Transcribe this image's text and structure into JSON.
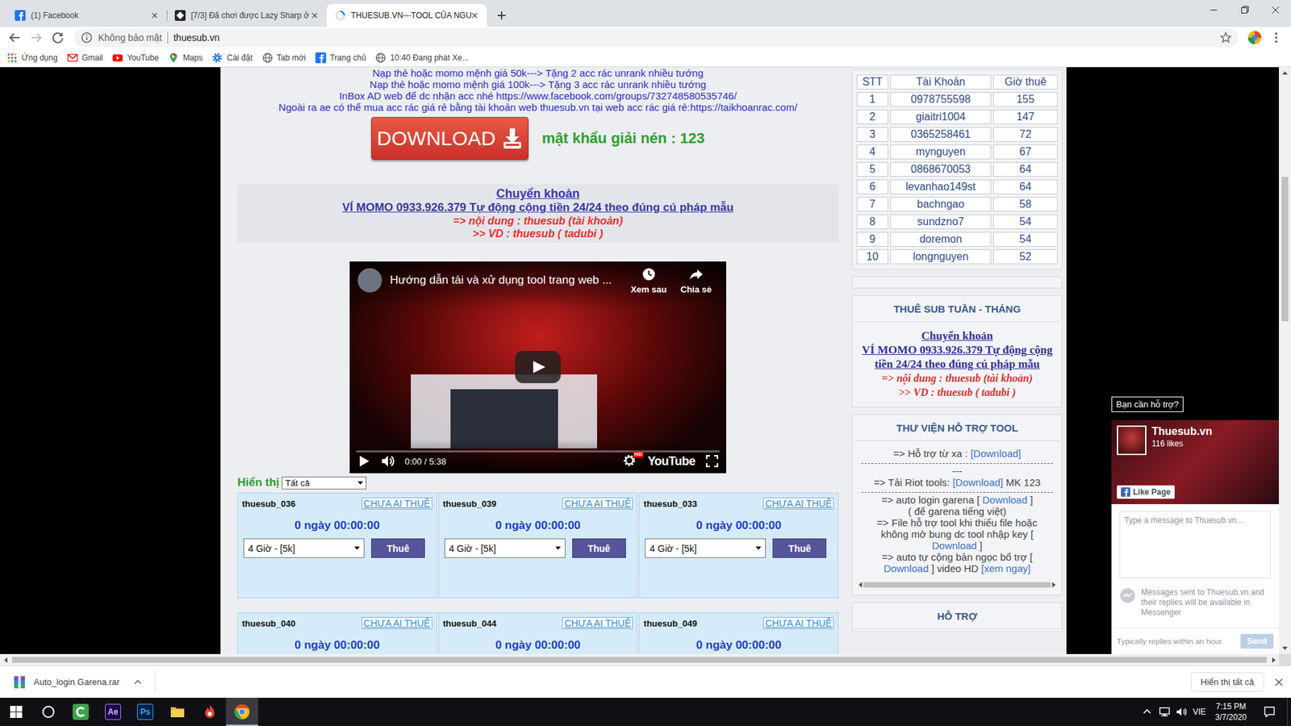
{
  "browser": {
    "tabs": [
      {
        "label": "(1) Facebook",
        "kind": "facebook",
        "selected": false
      },
      {
        "label": "[7/3] Đã chơi được Lazy Sharp ở",
        "kind": "forum",
        "selected": false
      },
      {
        "label": "THUESUB.VN---TOOL CỦA NGU",
        "kind": "site",
        "selected": true
      }
    ],
    "forward_disabled": true,
    "address": {
      "security": "Không bảo mật",
      "url": "thuesub.vn"
    },
    "bookmarks": [
      {
        "label": "Ứng dụng",
        "kind": "apps"
      },
      {
        "label": "Gmail",
        "kind": "gmail"
      },
      {
        "label": "YouTube",
        "kind": "youtube"
      },
      {
        "label": "Maps",
        "kind": "maps"
      },
      {
        "label": "Cài đặt",
        "kind": "settings"
      },
      {
        "label": "Tab mới",
        "kind": "globe"
      },
      {
        "label": "Trang chủ",
        "kind": "facebook"
      },
      {
        "label": "10:40 Đang phát Xe...",
        "kind": "globe"
      }
    ]
  },
  "page": {
    "promo_lines": [
      "Nạp thẻ hoặc momo mệnh giá 50k---> Tặng 2 acc rác unrank nhiều tướng",
      "Nạp thẻ hoặc momo mệnh giá 100k---> Tặng 3 acc rác unrank nhiều tướng",
      "InBox AD web để dc nhận acc nhé https://www.facebook.com/groups/732748580535746/",
      "Ngoài ra ae có thể mua acc rác giá rẻ bằng tài khoản web thuesub.vn tại web acc rác giá rẻ:https://taikhoanrac.com/"
    ],
    "download_button": "DOWNLOAD",
    "unzip_password": "mật khẩu giải nén : 123",
    "payment": {
      "title": "Chuyển khoản ",
      "wallet": "VÍ MOMO 0933.926.379 Tự động cộng tiền 24/24 theo đúng cú pháp mẫu ",
      "content": "=> nội dung : thuesub (tài khoản)",
      "example": ">> VD : thuesub ( tadubi )"
    },
    "video": {
      "title": "Hướng dẫn tải và xử dụng tool trang web ...",
      "watch_later": "Xem sau",
      "share": "Chia sẻ",
      "time": "0:00 / 5:38",
      "hd_badge": "HD",
      "brand": "YouTube",
      "level": 0
    },
    "filter": {
      "label": "Hiển thị",
      "value": "Tất cả"
    },
    "accounts": [
      {
        "name": "thuesub_036",
        "status": "CHƯA AI THUÊ",
        "time": "0 ngày 00:00:00",
        "plan": "4 Giờ - [5k]",
        "button": "Thuê"
      },
      {
        "name": "thuesub_039",
        "status": "CHƯA AI THUÊ",
        "time": "0 ngày 00:00:00",
        "plan": "4 Giờ - [5k]",
        "button": "Thuê"
      },
      {
        "name": "thuesub_033",
        "status": "CHƯA AI THUÊ",
        "time": "0 ngày 00:00:00",
        "plan": "4 Giờ - [5k]",
        "button": "Thuê"
      },
      {
        "name": "thuesub_040",
        "status": "CHƯA AI THUÊ",
        "time": "0 ngày 00:00:00"
      },
      {
        "name": "thuesub_044",
        "status": "CHƯA AI THUÊ",
        "time": "0 ngày 00:00:00"
      },
      {
        "name": "thuesub_049",
        "status": "CHƯA AI THUÊ",
        "time": "0 ngày 00:00:00"
      }
    ]
  },
  "sidebar": {
    "leaderboard": {
      "columns": [
        "STT",
        "Tài Khoản",
        "Giờ thuê"
      ],
      "rows": [
        [
          "1",
          "0978755598",
          "155"
        ],
        [
          "2",
          "giaitri1004",
          "147"
        ],
        [
          "3",
          "0365258461",
          "72"
        ],
        [
          "4",
          "mynguyen",
          "67"
        ],
        [
          "5",
          "0868670053",
          "64"
        ],
        [
          "6",
          "levanhao149st",
          "64"
        ],
        [
          "7",
          "bachngao",
          "58"
        ],
        [
          "8",
          "sundzno7",
          "54"
        ],
        [
          "9",
          "doremon",
          "54"
        ],
        [
          "10",
          "longnguyen",
          "52"
        ]
      ]
    },
    "weekly": {
      "title": "THUÊ SUB TUẦN - THÁNG",
      "transfer": "Chuyển khoản ",
      "wallet": "VÍ MOMO 0933.926.379 Tự động cộng tiền 24/24 theo đúng cú pháp mẫu ",
      "content": "=> nội dung : thuesub (tài khoản)",
      "example": ">> VD : thuesub ( tadubi )"
    },
    "library": {
      "title": "THƯ VIỆN HỖ TRỢ TOOL",
      "blocks": [
        {
          "kind": "line",
          "segments": [
            {
              "text": "=> Hỗ trợ từ xa : ",
              "kind": "text"
            },
            {
              "text": "[Download]",
              "kind": "link"
            }
          ]
        },
        {
          "kind": "rule"
        },
        {
          "kind": "line",
          "segments": [
            {
              "text": "---",
              "kind": "text"
            }
          ]
        },
        {
          "kind": "line",
          "segments": [
            {
              "text": "=> Tải Riot tools: ",
              "kind": "text"
            },
            {
              "text": "[Download]",
              "kind": "link"
            },
            {
              "text": " MK 123",
              "kind": "text"
            }
          ]
        },
        {
          "kind": "rule"
        },
        {
          "kind": "line",
          "segments": [
            {
              "text": "=> auto login garena [ ",
              "kind": "text"
            },
            {
              "text": "Download",
              "kind": "link"
            },
            {
              "text": " ]",
              "kind": "text"
            }
          ]
        },
        {
          "kind": "line",
          "segments": [
            {
              "text": "( để garena tiếng việt)",
              "kind": "text"
            }
          ]
        },
        {
          "kind": "line",
          "segments": [
            {
              "text": "=> File hỗ trợ tool khi thiếu file hoặc không mở bung dc tool nhập key [ ",
              "kind": "text"
            },
            {
              "text": "Download",
              "kind": "link"
            },
            {
              "text": " ]",
              "kind": "text"
            }
          ]
        },
        {
          "kind": "line",
          "segments": [
            {
              "text": "=> auto tự cộng bản ngọc bổ trợ [ ",
              "kind": "text"
            },
            {
              "text": "Download",
              "kind": "link"
            },
            {
              "text": " ] video HD ",
              "kind": "text"
            },
            {
              "text": "[xem ngay]",
              "kind": "link"
            }
          ]
        }
      ]
    },
    "support": {
      "title": "HỖ TRỢ"
    }
  },
  "messenger": {
    "label": "Bạn cần hỗ trợ?",
    "page_name": "Thuesub.vn",
    "likes": "116 likes",
    "like_button": "Like Page",
    "placeholder": "Type a message to Thuesub.vn...",
    "notice": "Messages sent to Thuesub.vn and their replies will be available in Messenger",
    "reply_time": "Typically replies within an hour",
    "send": "Send"
  },
  "downloads": {
    "file": "Auto_login Garena.rar",
    "show_all": "Hiển thị tất cả"
  },
  "taskbar": {
    "apps": [
      {
        "kind": "camtasia",
        "active": false
      },
      {
        "kind": "ae",
        "label": "Ae",
        "active": false
      },
      {
        "kind": "ps",
        "label": "Ps",
        "active": false
      },
      {
        "kind": "folder",
        "active": false
      },
      {
        "kind": "garena",
        "active": false
      },
      {
        "kind": "chrome",
        "active": true
      }
    ],
    "language": "VIE",
    "time": "7:15 PM",
    "date": "3/7/2020"
  }
}
